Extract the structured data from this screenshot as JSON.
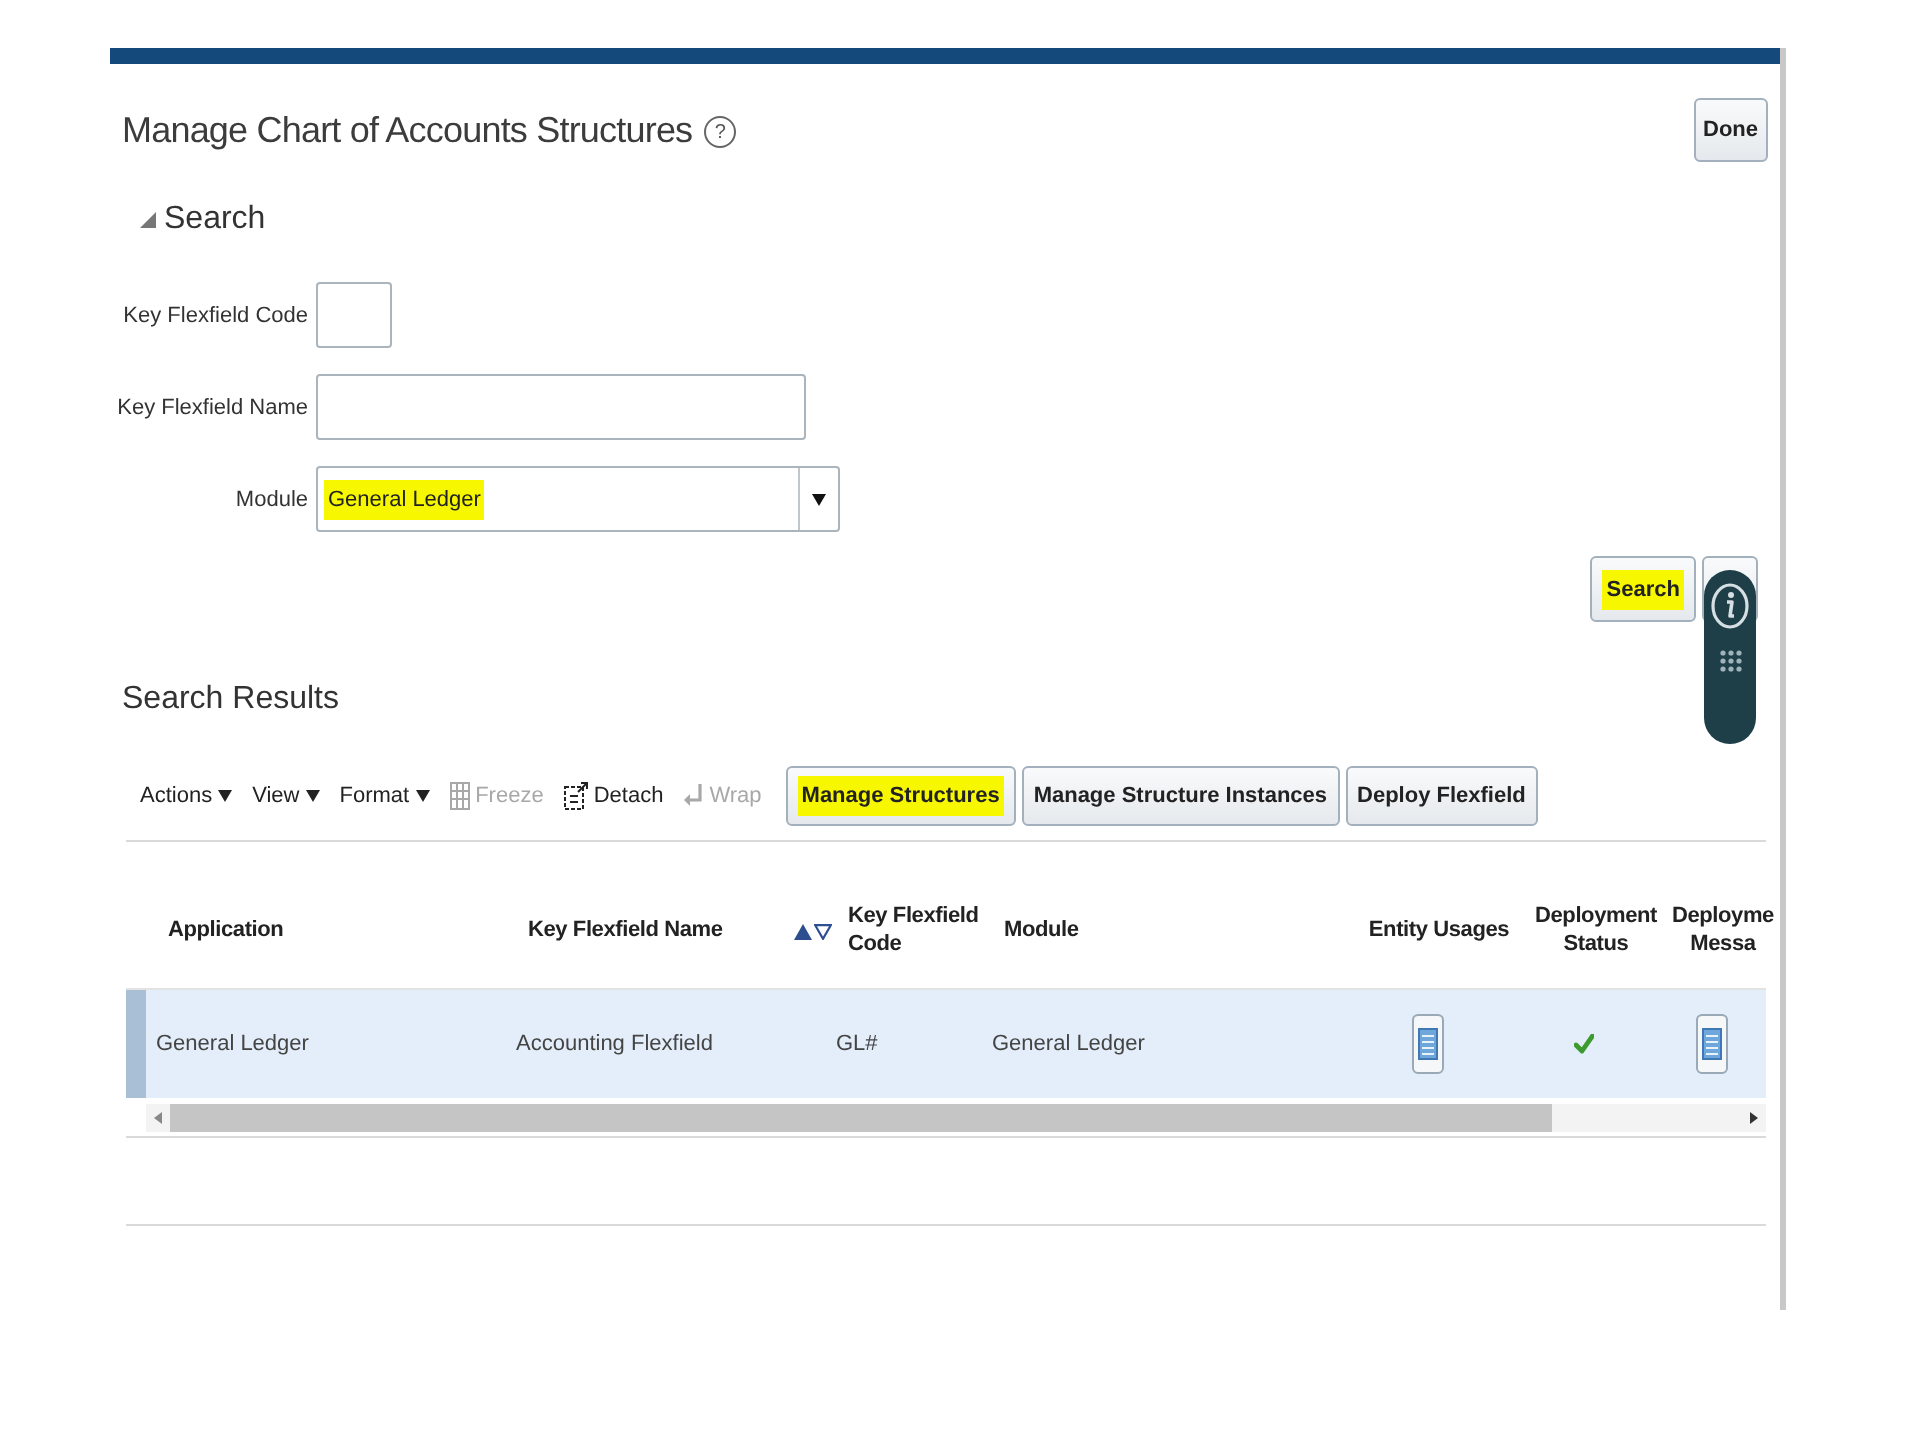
{
  "header": {
    "title": "Manage Chart of Accounts Structures",
    "help": "?",
    "done_button": "Done"
  },
  "search": {
    "title": "Search",
    "expanded": true,
    "fields": [
      {
        "kind": "text",
        "label": "Key Flexfield Code",
        "highlighted": false
      },
      {
        "kind": "text",
        "label": "Key Flexfield Name",
        "highlighted": false
      },
      {
        "kind": "select",
        "label": "Module",
        "value": "General Ledger",
        "highlighted": true
      }
    ],
    "buttons": [
      {
        "label": "Search",
        "highlighted": true
      }
    ]
  },
  "results": {
    "title": "Search Results",
    "toolbar": {
      "menus": [
        {
          "label": "Actions"
        },
        {
          "label": "View"
        },
        {
          "label": "Format"
        }
      ],
      "freeze": {
        "label": "Freeze",
        "disabled": true
      },
      "detach": {
        "label": "Detach",
        "disabled": false
      },
      "wrap": {
        "label": "Wrap",
        "disabled": true
      },
      "buttons": [
        {
          "label": "Manage Structures",
          "highlighted": true
        },
        {
          "label": "Manage Structure Instances",
          "highlighted": false
        },
        {
          "label": "Deploy Flexfield",
          "highlighted": false
        }
      ]
    },
    "table": {
      "columns": [
        {
          "label": "Application",
          "sortable": false
        },
        {
          "label": "Key Flexfield Name",
          "sortable": true
        },
        {
          "label": "Key Flexfield\nCode",
          "sortable": false
        },
        {
          "label": "Module",
          "sortable": false
        },
        {
          "label": "Entity Usages",
          "sortable": false
        },
        {
          "label": "Deployment\nStatus",
          "sortable": false
        },
        {
          "label": "Deployme\nMessa",
          "sortable": false
        }
      ],
      "rows": [
        {
          "selected": true,
          "application": "General Ledger",
          "key_flexfield_name": "Accounting Flexfield",
          "key_flexfield_code": "GL#",
          "module": "General Ledger",
          "deployed": true
        }
      ]
    }
  }
}
